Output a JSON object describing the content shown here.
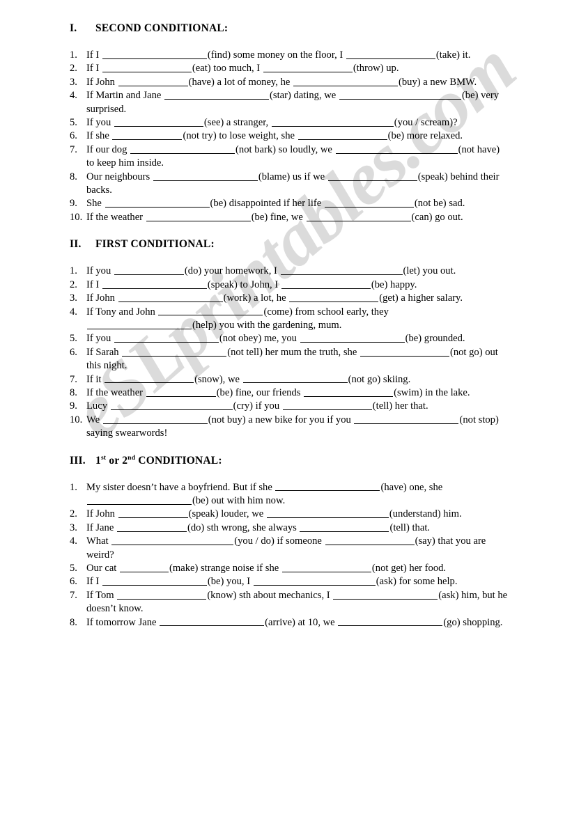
{
  "document": {
    "type": "worksheet",
    "watermark": "eSLprintables.com"
  },
  "sections": [
    {
      "numeral": "I.",
      "title": "SECOND CONDITIONAL:",
      "items": [
        {
          "n": "1.",
          "parts": [
            {
              "t": "If I"
            },
            {
              "b": "xl"
            },
            {
              "t": "(find) some money on the floor, I"
            },
            {
              "b": "l"
            },
            {
              "t": "(take) it."
            }
          ]
        },
        {
          "n": "2.",
          "parts": [
            {
              "t": "If I"
            },
            {
              "b": "l"
            },
            {
              "t": "(eat) too much, I"
            },
            {
              "b": "l"
            },
            {
              "t": "(throw) up."
            }
          ]
        },
        {
          "n": "3.",
          "parts": [
            {
              "t": "If John"
            },
            {
              "b": "m"
            },
            {
              "t": "(have) a lot of money, he"
            },
            {
              "b": "xl"
            },
            {
              "t": "(buy) a new BMW."
            }
          ]
        },
        {
          "n": "4.",
          "parts": [
            {
              "t": "If Martin and Jane"
            },
            {
              "b": "xl"
            },
            {
              "t": "(star) dating, we"
            },
            {
              "b": "xxl"
            },
            {
              "t": "(be) very surprised."
            }
          ]
        },
        {
          "n": "5.",
          "parts": [
            {
              "t": "If you"
            },
            {
              "b": "l"
            },
            {
              "t": "(see) a stranger,"
            },
            {
              "b": "xxl"
            },
            {
              "t": "(you / scream)?"
            }
          ]
        },
        {
          "n": "6.",
          "parts": [
            {
              "t": "If she"
            },
            {
              "b": "m"
            },
            {
              "t": "(not try) to lose weight, she"
            },
            {
              "b": "l"
            },
            {
              "t": "(be) more relaxed."
            }
          ]
        },
        {
          "n": "7.",
          "parts": [
            {
              "t": "If our dog"
            },
            {
              "b": "xl"
            },
            {
              "t": "(not bark) so loudly, we"
            },
            {
              "b": "xxl"
            },
            {
              "t": "(not have) to keep him inside."
            }
          ]
        },
        {
          "n": "8.",
          "parts": [
            {
              "t": "Our neighbours"
            },
            {
              "b": "xl"
            },
            {
              "t": "(blame) us if we"
            },
            {
              "b": "l"
            },
            {
              "t": "(speak) behind their backs."
            }
          ]
        },
        {
          "n": "9.",
          "parts": [
            {
              "t": "She"
            },
            {
              "b": "xl"
            },
            {
              "t": "(be) disappointed if her life"
            },
            {
              "b": "l"
            },
            {
              "t": "(not be) sad."
            }
          ]
        },
        {
          "n": "10.",
          "parts": [
            {
              "t": "If the weather"
            },
            {
              "b": "xl"
            },
            {
              "t": "(be) fine, we"
            },
            {
              "b": "xl"
            },
            {
              "t": "(can) go out."
            }
          ]
        }
      ]
    },
    {
      "numeral": "II.",
      "title": "FIRST CONDITIONAL:",
      "items": [
        {
          "n": "1.",
          "parts": [
            {
              "t": "If you"
            },
            {
              "b": "m"
            },
            {
              "t": "(do) your homework, I"
            },
            {
              "b": "xxl"
            },
            {
              "t": "(let) you out."
            }
          ]
        },
        {
          "n": "2.",
          "parts": [
            {
              "t": "If I"
            },
            {
              "b": "xl"
            },
            {
              "t": "(speak) to John, I"
            },
            {
              "b": "l"
            },
            {
              "t": "(be) happy."
            }
          ]
        },
        {
          "n": "3.",
          "parts": [
            {
              "t": "If John"
            },
            {
              "b": "xl"
            },
            {
              "t": "(work) a lot, he"
            },
            {
              "b": "l"
            },
            {
              "t": "(get) a higher salary."
            }
          ]
        },
        {
          "n": "4.",
          "parts": [
            {
              "t": "If Tony and John"
            },
            {
              "b": "xl"
            },
            {
              "t": "(come) from school early, they"
            },
            {
              "nl": true
            },
            {
              "b": "xl"
            },
            {
              "t": "(help) you with the gardening, mum."
            }
          ]
        },
        {
          "n": "5.",
          "parts": [
            {
              "t": "If you"
            },
            {
              "b": "xl"
            },
            {
              "t": "(not obey) me, you"
            },
            {
              "b": "xl"
            },
            {
              "t": "(be) grounded."
            }
          ]
        },
        {
          "n": "6.",
          "parts": [
            {
              "t": "If Sarah"
            },
            {
              "b": "xl"
            },
            {
              "t": "(not tell) her mum the truth, she"
            },
            {
              "b": "l"
            },
            {
              "t": "(not go) out this night."
            }
          ]
        },
        {
          "n": "7.",
          "parts": [
            {
              "t": "If it"
            },
            {
              "b": "l"
            },
            {
              "t": "(snow), we"
            },
            {
              "b": "xl"
            },
            {
              "t": "(not go) skiing."
            }
          ]
        },
        {
          "n": "8.",
          "parts": [
            {
              "t": "If the weather"
            },
            {
              "b": "m"
            },
            {
              "t": "(be) fine, our friends"
            },
            {
              "b": "l"
            },
            {
              "t": "(swim) in the lake."
            }
          ]
        },
        {
          "n": "9.",
          "parts": [
            {
              "t": "Lucy"
            },
            {
              "b": "xxl"
            },
            {
              "t": "(cry) if you"
            },
            {
              "b": "l"
            },
            {
              "t": "(tell) her that."
            }
          ]
        },
        {
          "n": "10.",
          "parts": [
            {
              "t": "We"
            },
            {
              "b": "xl"
            },
            {
              "t": "(not buy) a new bike for you if you"
            },
            {
              "b": "xl"
            },
            {
              "t": "(not stop) saying swearwords!"
            }
          ]
        }
      ]
    },
    {
      "numeral": "III.",
      "title_pre": "1",
      "title_sup1": "st",
      "title_mid": " or 2",
      "title_sup2": "nd",
      "title_post": " CONDITIONAL:",
      "items": [
        {
          "n": "1.",
          "parts": [
            {
              "t": "My sister doesn’t have a boyfriend. But if she"
            },
            {
              "b": "xl"
            },
            {
              "t": "(have) one, she"
            },
            {
              "nl": true
            },
            {
              "b": "xl"
            },
            {
              "t": "(be) out with him now."
            }
          ]
        },
        {
          "n": "2.",
          "parts": [
            {
              "t": "If John"
            },
            {
              "b": "m"
            },
            {
              "t": "(speak) louder, we"
            },
            {
              "b": "xxl"
            },
            {
              "t": "(understand) him."
            }
          ]
        },
        {
          "n": "3.",
          "parts": [
            {
              "t": "If Jane"
            },
            {
              "b": "m"
            },
            {
              "t": "(do) sth wrong, she always"
            },
            {
              "b": "l"
            },
            {
              "t": "(tell) that."
            }
          ]
        },
        {
          "n": "4.",
          "parts": [
            {
              "t": "What"
            },
            {
              "b": "xxl"
            },
            {
              "t": "(you / do) if someone"
            },
            {
              "b": "l"
            },
            {
              "t": "(say) that you are weird?"
            }
          ]
        },
        {
          "n": "5.",
          "parts": [
            {
              "t": "Our cat"
            },
            {
              "b": "s"
            },
            {
              "t": "(make) strange noise if she"
            },
            {
              "b": "l"
            },
            {
              "t": "(not get) her food."
            }
          ]
        },
        {
          "n": "6.",
          "parts": [
            {
              "t": "If I"
            },
            {
              "b": "xl"
            },
            {
              "t": "(be) you, I"
            },
            {
              "b": "xxl"
            },
            {
              "t": "(ask) for some help."
            }
          ]
        },
        {
          "n": "7.",
          "parts": [
            {
              "t": "If Tom"
            },
            {
              "b": "l"
            },
            {
              "t": "(know) sth about mechanics, I"
            },
            {
              "b": "xl"
            },
            {
              "t": "(ask) him, but he doesn’t know."
            }
          ]
        },
        {
          "n": "8.",
          "parts": [
            {
              "t": "If tomorrow Jane"
            },
            {
              "b": "xl"
            },
            {
              "t": "(arrive) at 10, we"
            },
            {
              "b": "xl"
            },
            {
              "t": "(go) shopping."
            }
          ]
        }
      ]
    }
  ]
}
